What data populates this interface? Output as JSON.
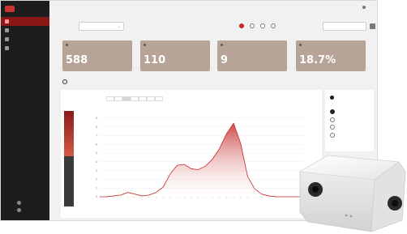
{
  "sidebar": {
    "logo_text": "",
    "nav": [
      {
        "label": "",
        "icon": "dashboard-icon"
      },
      {
        "label": "",
        "icon": "store-icon"
      },
      {
        "label": "",
        "icon": "zone-icon"
      },
      {
        "label": "",
        "icon": "settings-icon"
      }
    ],
    "bottom": [
      {
        "label": "",
        "icon": "user-icon"
      },
      {
        "label": "",
        "icon": "logout-icon"
      }
    ]
  },
  "header": {
    "title": "",
    "user": ""
  },
  "filter": {
    "label": "",
    "selected": "",
    "ranges": [
      {
        "label": "",
        "selected": true
      },
      {
        "label": "",
        "selected": false
      },
      {
        "label": "",
        "selected": false
      },
      {
        "label": "",
        "selected": false
      }
    ],
    "date_range": ""
  },
  "cards": [
    {
      "label": "",
      "value": "588",
      "change": "",
      "trend": "up"
    },
    {
      "label": "",
      "value": "110",
      "change": "",
      "trend": "up"
    },
    {
      "label": "",
      "value": "9",
      "change": "",
      "trend": "down"
    },
    {
      "label": "",
      "value": "18.7%",
      "change": "",
      "trend": "down"
    }
  ],
  "trend": {
    "title": "",
    "tabs": [
      "",
      "",
      "",
      "",
      "",
      "",
      ""
    ],
    "active_tab": 2,
    "legend_link": "",
    "left_bar_top": "",
    "left_bar_bottom": ""
  },
  "side_panel": {
    "title": "",
    "options": [
      {
        "label": "",
        "selected": true
      },
      {
        "label": "",
        "selected": false
      },
      {
        "label": "",
        "selected": false
      },
      {
        "label": "",
        "selected": false
      }
    ]
  },
  "chart_data": {
    "type": "area",
    "title": "",
    "xlabel": "",
    "ylabel": "",
    "x_count": 30,
    "ylim": [
      0,
      10
    ],
    "y_ticks": [
      0,
      1,
      2,
      3,
      4,
      5,
      6,
      7,
      8,
      9
    ],
    "values": [
      0,
      0,
      0.1,
      0.2,
      0.5,
      0.3,
      0.1,
      0.2,
      0.5,
      1.1,
      2.6,
      3.6,
      3.7,
      3.2,
      3.1,
      3.5,
      4.3,
      5.5,
      7.2,
      8.4,
      6.1,
      2.3,
      0.9,
      0.3,
      0.1,
      0,
      0,
      0,
      0,
      0
    ]
  },
  "colors": {
    "accent": "#c62828",
    "card_bg": "#b7a397",
    "sidebar": "#1d1d1d"
  }
}
